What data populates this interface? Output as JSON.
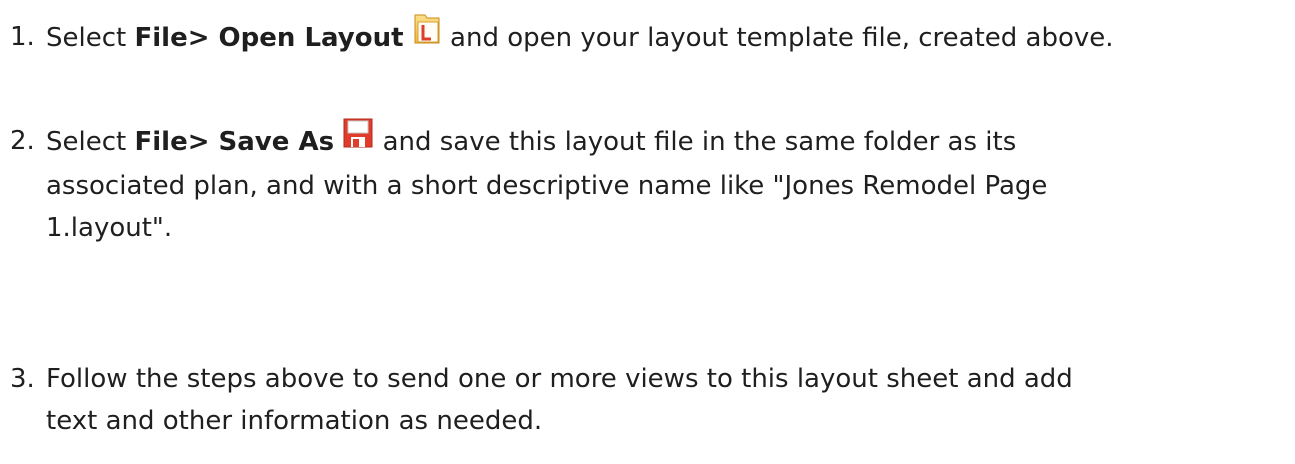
{
  "steps": [
    {
      "number": "1.",
      "prefix": "Select ",
      "command": "File> Open Layout",
      "icon": "open-layout-icon",
      "suffix": " and open your layout template file, created above."
    },
    {
      "number": "2.",
      "prefix": "Select ",
      "command": "File> Save As",
      "icon": "save-as-icon",
      "line1_suffix": " and save this layout file in the same folder as its",
      "line2": "associated plan, and with a short descriptive name like \"Jones Remodel Page",
      "line3": "1.layout\"."
    },
    {
      "number": "3.",
      "line1": "Follow the steps above to send one or more views to this layout sheet and add",
      "line2": "text and other information as needed."
    }
  ],
  "colors": {
    "text": "#1f1f1f",
    "icon_red": "#e03c2c",
    "icon_yellow": "#f6c84f"
  }
}
